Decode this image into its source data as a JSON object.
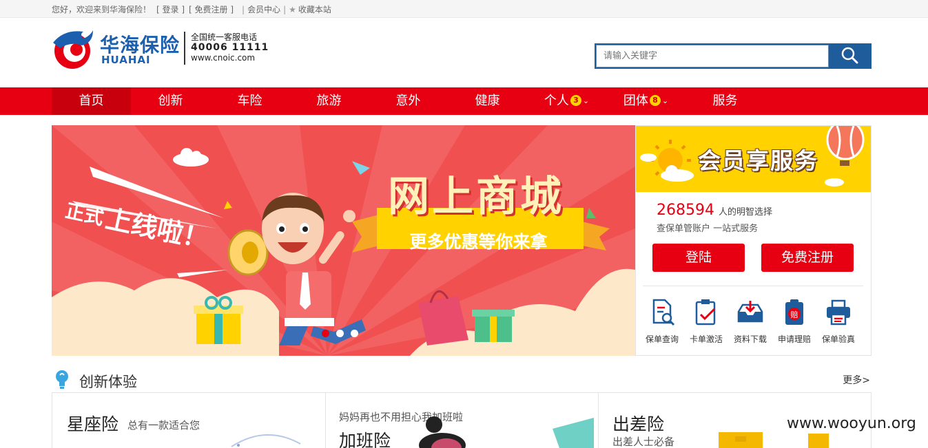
{
  "topbar": {
    "welcome": "您好，欢迎来到华海保险！",
    "login": "[ 登录 ]",
    "register": "[ 免费注册 ]",
    "member_center": "会员中心",
    "bookmark": "收藏本站"
  },
  "logo": {
    "cn": "华海保险",
    "en": "HUAHAI",
    "hotline_label": "全国统一客服电话",
    "hotline_number": "40006 11111",
    "website": "www.cnoic.com"
  },
  "search": {
    "placeholder": "请输入关键字"
  },
  "nav": {
    "items": [
      {
        "label": "首页"
      },
      {
        "label": "创新"
      },
      {
        "label": "车险"
      },
      {
        "label": "旅游"
      },
      {
        "label": "意外"
      },
      {
        "label": "健康"
      },
      {
        "label": "个人",
        "badge": "3"
      },
      {
        "label": "团体",
        "badge": "8"
      },
      {
        "label": "服务"
      }
    ]
  },
  "banner": {
    "title": "网上商城",
    "ribbon": "更多优惠等你来拿",
    "launch_small": "正式",
    "launch_big": "上线啦！"
  },
  "member": {
    "header_title": "会员享服务",
    "count": "268594",
    "count_suffix": "人的明智选择",
    "tagline": "查保单管账户 一站式服务",
    "login_button": "登陆",
    "register_button": "免费注册",
    "tools": [
      {
        "label": "保单查询",
        "icon": "policy-search-icon"
      },
      {
        "label": "卡单激活",
        "icon": "card-activate-icon"
      },
      {
        "label": "资料下载",
        "icon": "download-icon"
      },
      {
        "label": "申请理赔",
        "icon": "claim-icon"
      },
      {
        "label": "保单验真",
        "icon": "print-verify-icon"
      }
    ]
  },
  "section": {
    "title": "创新体验",
    "more": "更多>",
    "cards": [
      {
        "title": "星座险",
        "subtitle": "总有一款适合您"
      },
      {
        "title": "加班险",
        "subtitle": "妈妈再也不用担心我加班啦"
      },
      {
        "title": "出差险",
        "subtitle": "出差人士必备"
      }
    ]
  },
  "watermark": "www.wooyun.org",
  "colors": {
    "brand_red": "#e60012",
    "brand_blue": "#1b5fae",
    "accent_yellow": "#ffd200"
  }
}
